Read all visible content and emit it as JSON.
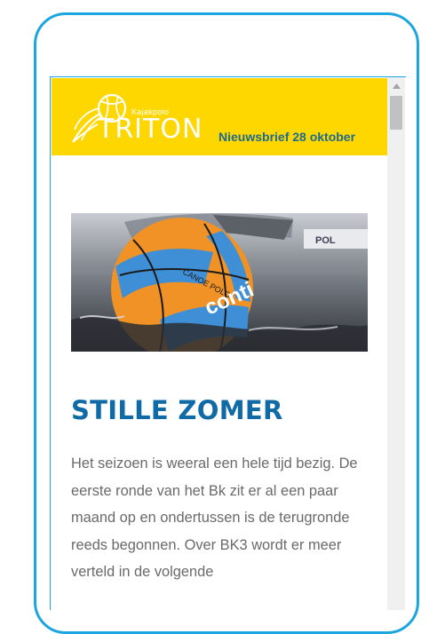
{
  "newsletter": {
    "logo_small": "Kajakpolo",
    "logo_big": "TRITON",
    "issue_title": "Nieuwsbrief 28 oktober",
    "brand_color": "#ffd700",
    "accent_color": "#0f6aa5"
  },
  "hero_image": {
    "ball_text_1": "CANOE POLO",
    "ball_text_2": "conti",
    "bg_sign": "POL"
  },
  "article": {
    "headline": "STILLE ZOMER",
    "body": "Het seizoen is weeral een hele tijd bezig. De eerste ronde van het Bk zit er al een paar maand op en ondertussen is de terugronde reeds begonnen. Over BK3 wordt er meer verteld in de volgende"
  },
  "icons": {
    "scroll_up": "triangle-up-icon",
    "logo": "volleyball-wing-logo"
  }
}
